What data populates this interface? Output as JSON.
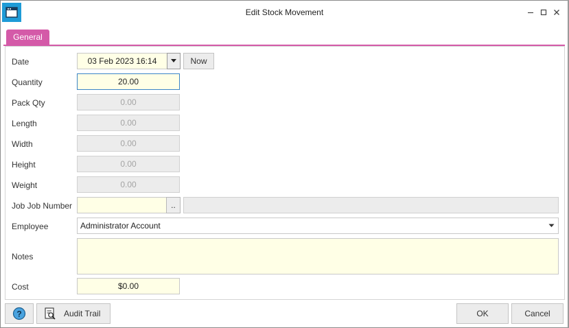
{
  "window": {
    "title": "Edit Stock Movement"
  },
  "tabs": {
    "general": "General"
  },
  "labels": {
    "date": "Date",
    "quantity": "Quantity",
    "pack_qty": "Pack Qty",
    "length": "Length",
    "width": "Width",
    "height": "Height",
    "weight": "Weight",
    "job_number": "Job Job Number",
    "employee": "Employee",
    "notes": "Notes",
    "cost": "Cost"
  },
  "values": {
    "date": "03 Feb 2023 16:14",
    "quantity": "20.00",
    "pack_qty": "0.00",
    "length": "0.00",
    "width": "0.00",
    "height": "0.00",
    "weight": "0.00",
    "job_number": "",
    "job_lookup": "..",
    "employee": "Administrator Account",
    "notes": "",
    "cost": "$0.00"
  },
  "buttons": {
    "now": "Now",
    "audit_trail": "Audit Trail",
    "ok": "OK",
    "cancel": "Cancel"
  },
  "colors": {
    "accent_tab": "#d45aa8",
    "input_bg": "#ffffe6",
    "app_icon": "#1e9bd7"
  }
}
